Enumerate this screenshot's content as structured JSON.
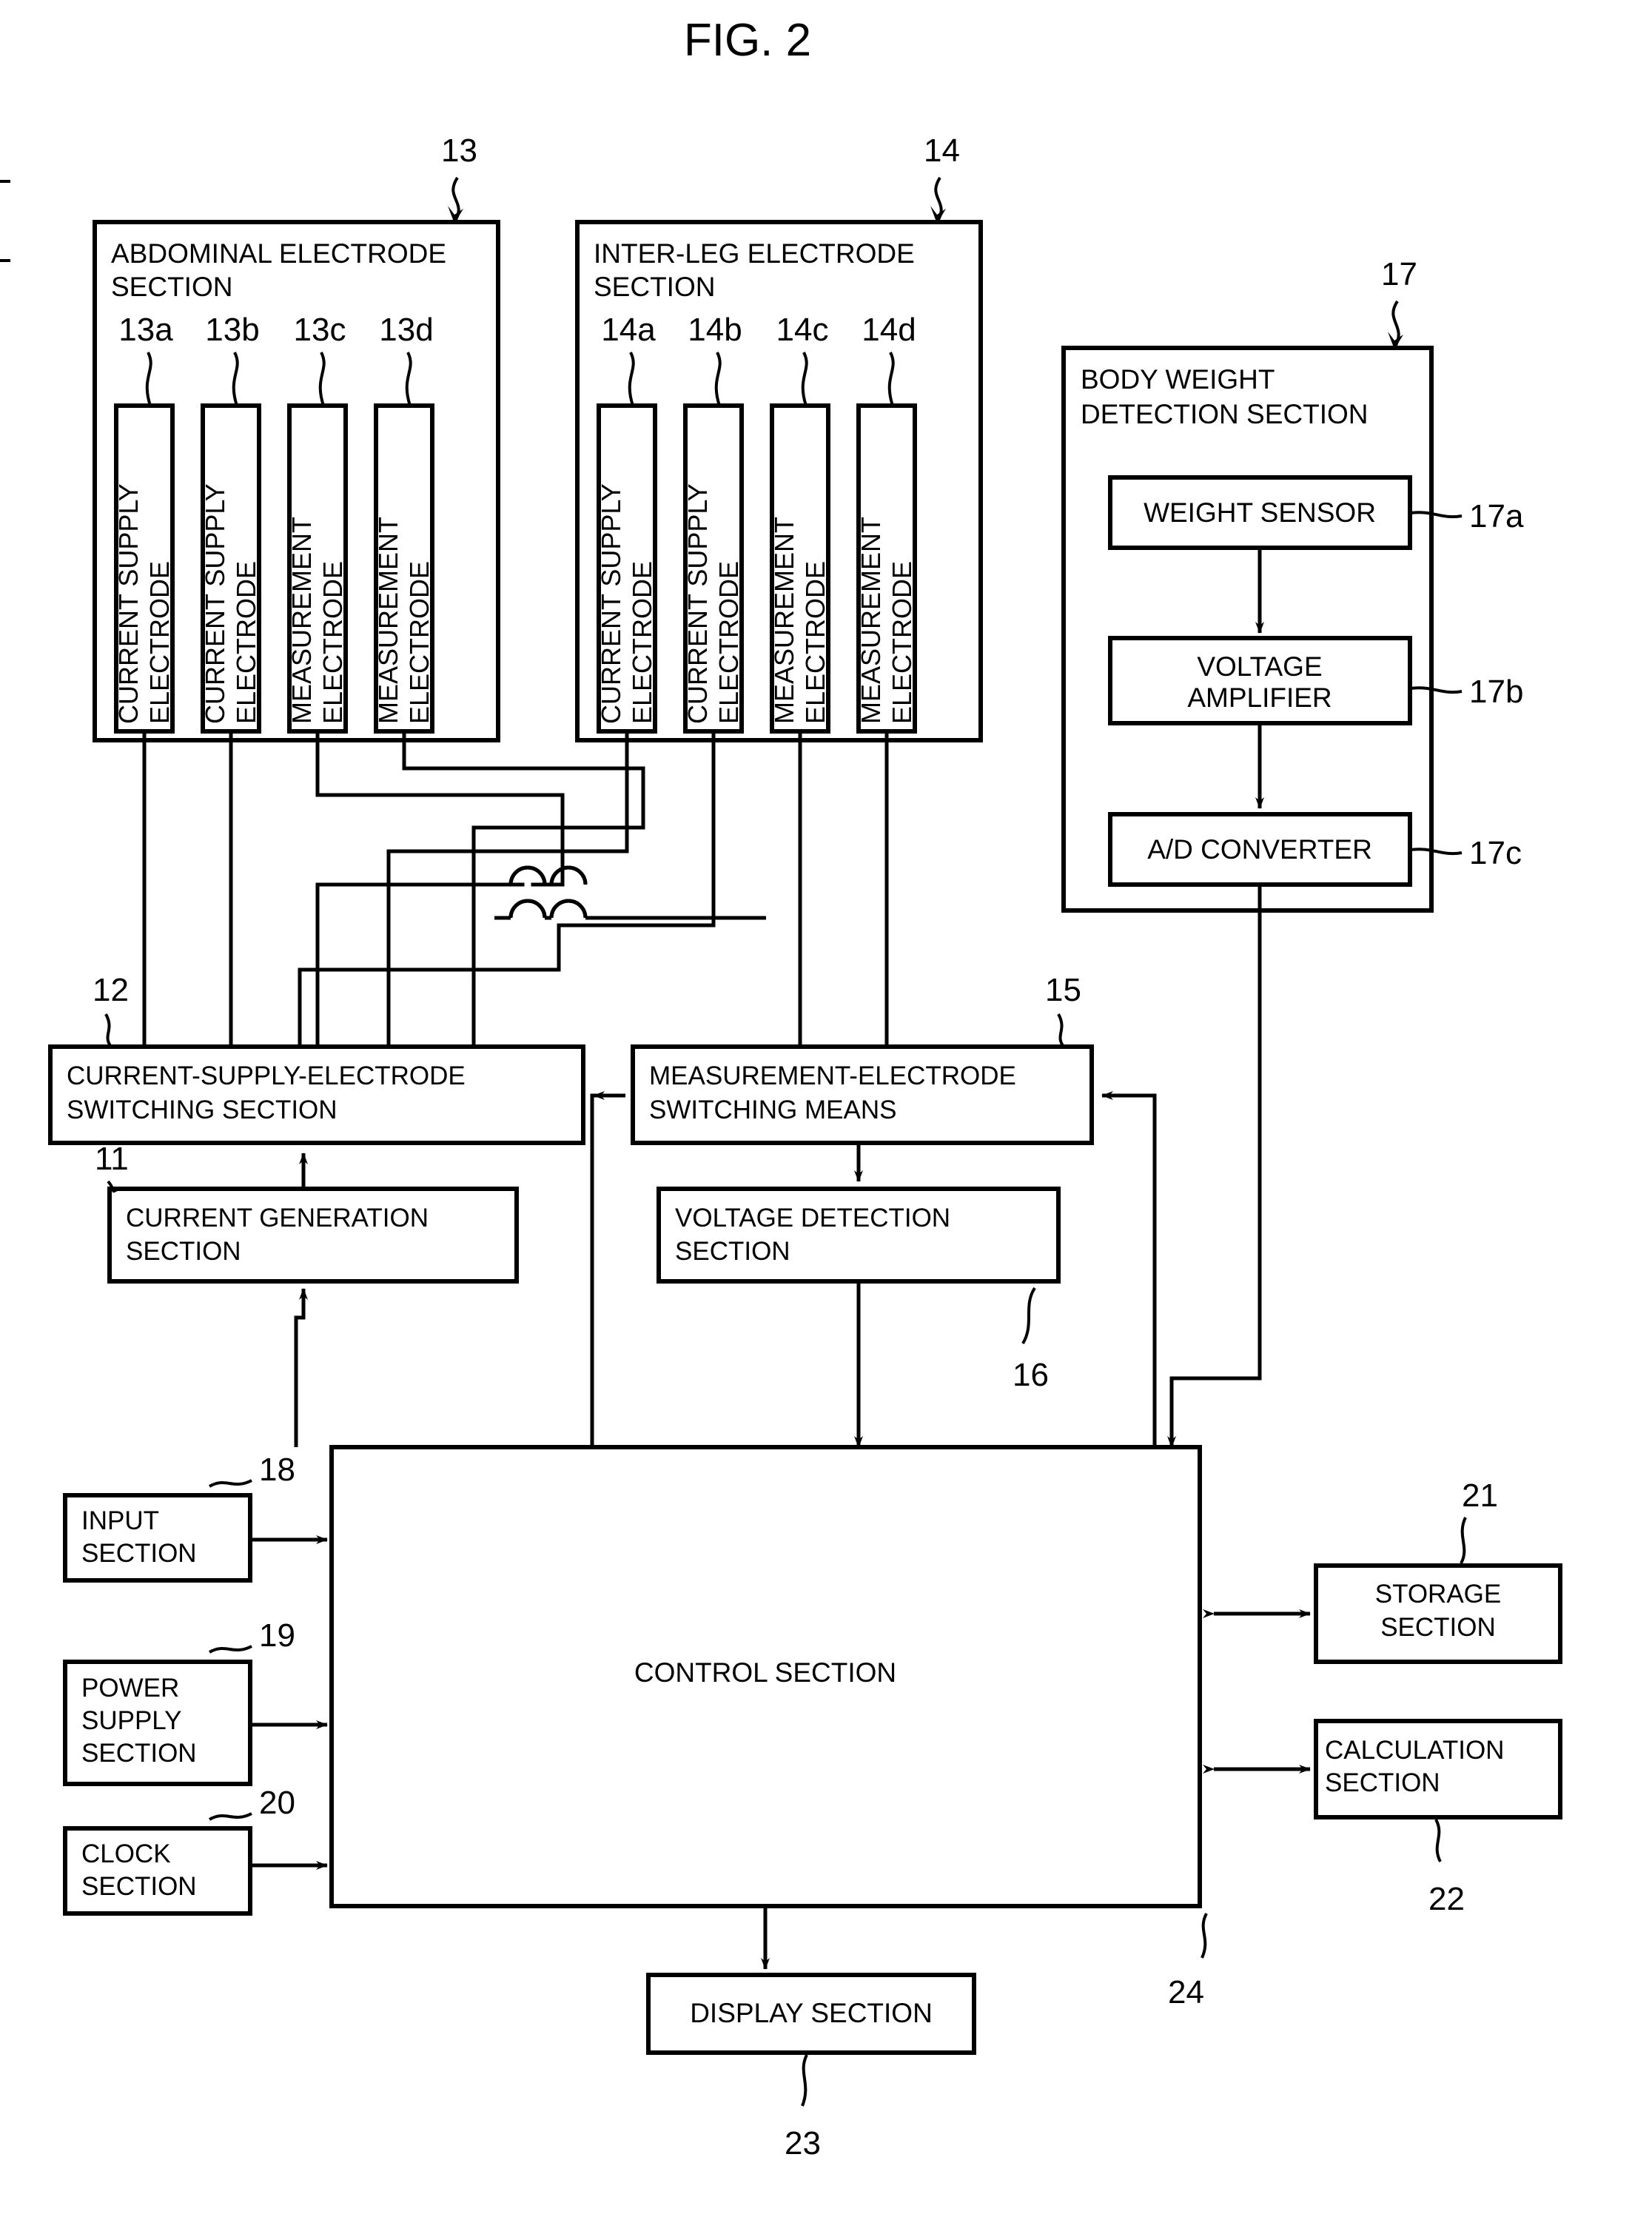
{
  "figure": {
    "title": "FIG. 2",
    "type": "block-diagram"
  },
  "sections": {
    "abdominal": {
      "ref": "13",
      "title_line1": "ABDOMINAL ELECTRODE",
      "title_line2": "SECTION",
      "electrodes": [
        {
          "ref": "13a",
          "line1": "CURRENT SUPPLY",
          "line2": "ELECTRODE"
        },
        {
          "ref": "13b",
          "line1": "CURRENT SUPPLY",
          "line2": "ELECTRODE"
        },
        {
          "ref": "13c",
          "line1": "MEASUREMENT",
          "line2": "ELECTRODE"
        },
        {
          "ref": "13d",
          "line1": "MEASUREMENT",
          "line2": "ELECTRODE"
        }
      ]
    },
    "interleg": {
      "ref": "14",
      "title_line1": "INTER-LEG ELECTRODE",
      "title_line2": "SECTION",
      "electrodes": [
        {
          "ref": "14a",
          "line1": "CURRENT SUPPLY",
          "line2": "ELECTRODE"
        },
        {
          "ref": "14b",
          "line1": "CURRENT SUPPLY",
          "line2": "ELECTRODE"
        },
        {
          "ref": "14c",
          "line1": "MEASUREMENT",
          "line2": "ELECTRODE"
        },
        {
          "ref": "14d",
          "line1": "MEASUREMENT",
          "line2": "ELECTRODE"
        }
      ]
    },
    "bodyweight": {
      "ref": "17",
      "title_line1": "BODY WEIGHT",
      "title_line2": "DETECTION SECTION",
      "blocks": [
        {
          "ref": "17a",
          "label": "WEIGHT SENSOR"
        },
        {
          "ref": "17b",
          "line1": "VOLTAGE",
          "line2": "AMPLIFIER"
        },
        {
          "ref": "17c",
          "label": "A/D CONVERTER"
        }
      ]
    }
  },
  "blocks": {
    "current_supply_switching": {
      "ref": "12",
      "line1": "CURRENT-SUPPLY-ELECTRODE",
      "line2": "SWITCHING SECTION"
    },
    "measurement_switching": {
      "ref": "15",
      "line1": "MEASUREMENT-ELECTRODE",
      "line2": "SWITCHING MEANS"
    },
    "current_generation": {
      "ref": "11",
      "line1": "CURRENT GENERATION",
      "line2": "SECTION"
    },
    "voltage_detection": {
      "ref": "16",
      "line1": "VOLTAGE DETECTION",
      "line2": "SECTION"
    },
    "input": {
      "ref": "18",
      "line1": "INPUT",
      "line2": "SECTION"
    },
    "power_supply": {
      "ref": "19",
      "line1": "POWER",
      "line2": "SUPPLY",
      "line3": "SECTION"
    },
    "clock": {
      "ref": "20",
      "line1": "CLOCK",
      "line2": "SECTION"
    },
    "control": {
      "ref": "24",
      "label": "CONTROL SECTION"
    },
    "storage": {
      "ref": "21",
      "line1": "STORAGE",
      "line2": "SECTION"
    },
    "calculation": {
      "ref": "22",
      "line1": "CALCULATION",
      "line2": "SECTION"
    },
    "display": {
      "ref": "23",
      "label": "DISPLAY SECTION"
    }
  },
  "colors": {
    "line": "#000000",
    "background": "#ffffff"
  }
}
